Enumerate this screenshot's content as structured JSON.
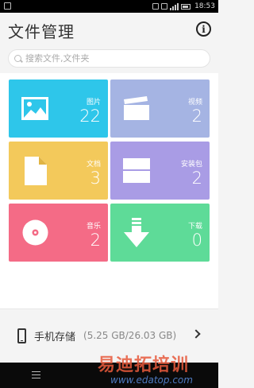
{
  "status_bar": {
    "time": "18:53"
  },
  "header": {
    "title": "文件管理",
    "info_icon": "info-icon"
  },
  "search": {
    "placeholder": "搜索文件,文件夹"
  },
  "categories": [
    {
      "label": "图片",
      "count": "22",
      "icon": "image-icon",
      "color": "#2ec6ea"
    },
    {
      "label": "视频",
      "count": "2",
      "icon": "video-clapper-icon",
      "color": "#a5b4e3"
    },
    {
      "label": "文档",
      "count": "3",
      "icon": "document-icon",
      "color": "#f3c95b"
    },
    {
      "label": "安装包",
      "count": "2",
      "icon": "package-icon",
      "color": "#a99ce5"
    },
    {
      "label": "音乐",
      "count": "2",
      "icon": "disc-icon",
      "color": "#f46b86"
    },
    {
      "label": "下载",
      "count": "0",
      "icon": "download-arrow-icon",
      "color": "#5edb98"
    }
  ],
  "storage": {
    "label": "手机存储",
    "size": "(5.25 GB/26.03 GB)"
  },
  "watermark": {
    "text": "易迪拓培训",
    "url": "www.edatop.com"
  }
}
